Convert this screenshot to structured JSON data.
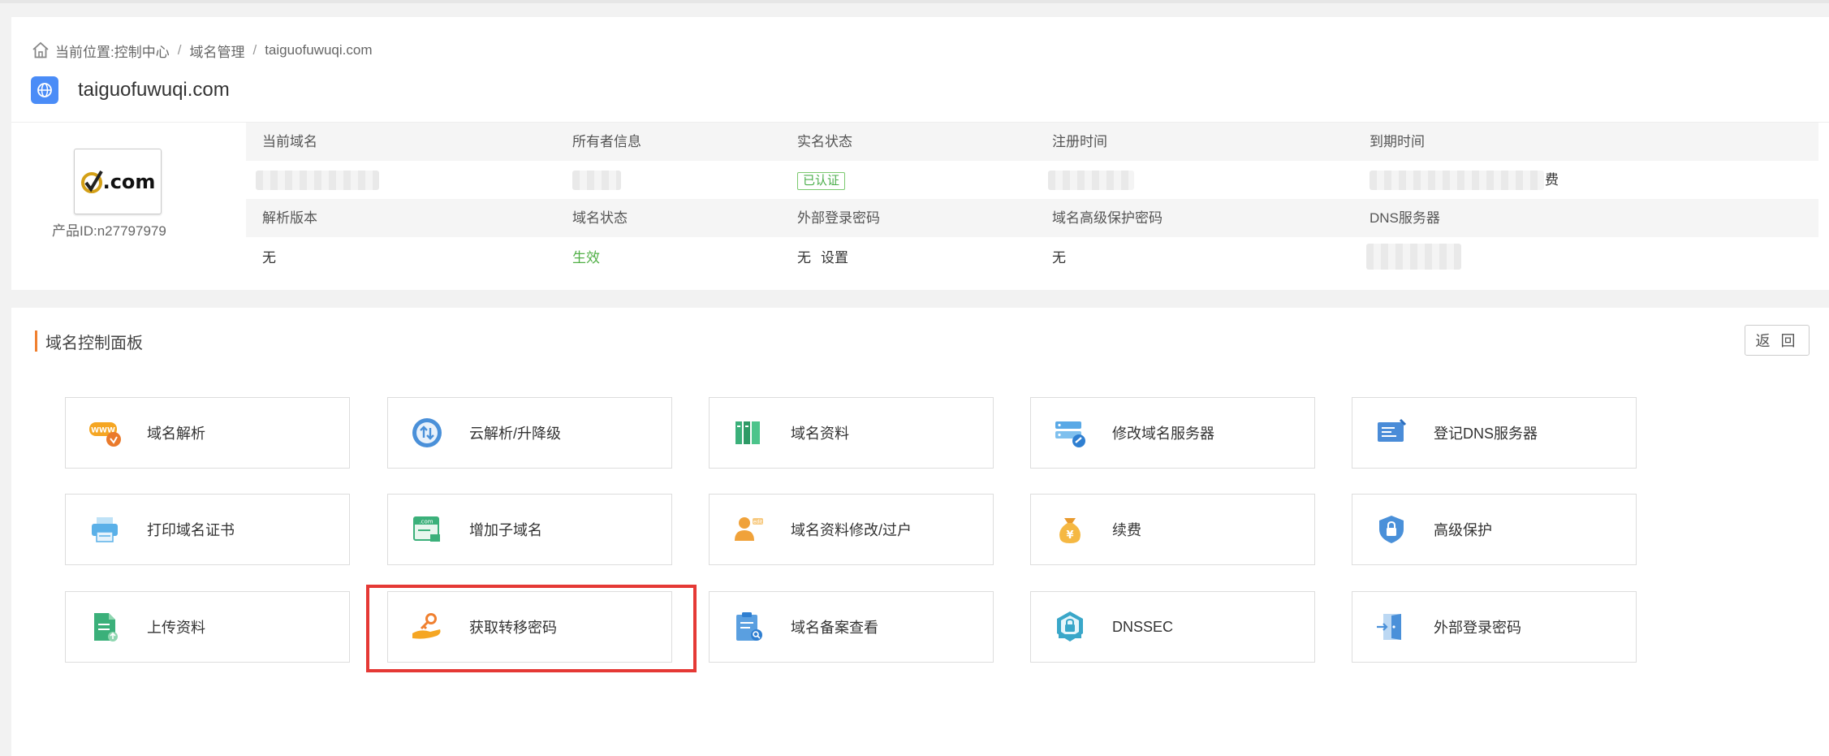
{
  "breadcrumb": {
    "prefix": "当前位置:",
    "items": [
      "控制中心",
      "域名管理",
      "taiguofuwuqi.com"
    ],
    "separator": "/"
  },
  "domain_title": "taiguofuwuqi.com",
  "logo_text": ".com",
  "product_id": "产品ID:n27797979",
  "info": {
    "row1_headers": [
      "当前域名",
      "所有者信息",
      "实名状态",
      "注册时间",
      "到期时间"
    ],
    "realname_badge": "已认证",
    "expire_suffix": "费",
    "row2_headers": [
      "解析版本",
      "域名状态",
      "外部登录密码",
      "域名高级保护密码",
      "DNS服务器"
    ],
    "row2_values": {
      "version": "无",
      "status": "生效",
      "ext_pwd": "无",
      "ext_pwd_action": "设置",
      "adv_pwd": "无"
    }
  },
  "panel": {
    "title": "域名控制面板",
    "back_label": "返 回"
  },
  "tiles": [
    {
      "label": "域名解析",
      "icon": "www-dns-icon"
    },
    {
      "label": "云解析/升降级",
      "icon": "cloud-upgrade-icon"
    },
    {
      "label": "域名资料",
      "icon": "books-icon"
    },
    {
      "label": "修改域名服务器",
      "icon": "server-edit-icon"
    },
    {
      "label": "登记DNS服务器",
      "icon": "dns-register-icon"
    },
    {
      "label": "打印域名证书",
      "icon": "printer-icon"
    },
    {
      "label": "增加子域名",
      "icon": "subdomain-icon"
    },
    {
      "label": "域名资料修改/过户",
      "icon": "user-transfer-icon"
    },
    {
      "label": "续费",
      "icon": "money-bag-icon"
    },
    {
      "label": "高级保护",
      "icon": "shield-lock-icon"
    },
    {
      "label": "上传资料",
      "icon": "upload-doc-icon"
    },
    {
      "label": "获取转移密码",
      "icon": "key-hand-icon"
    },
    {
      "label": "域名备案查看",
      "icon": "clipboard-search-icon"
    },
    {
      "label": "DNSSEC",
      "icon": "dnssec-shield-icon"
    },
    {
      "label": "外部登录密码",
      "icon": "door-login-icon"
    }
  ],
  "colors": {
    "accent_orange": "#f08030",
    "highlight_red": "#e53935",
    "status_green": "#52b048",
    "badge_blue": "#4a8cf7"
  }
}
